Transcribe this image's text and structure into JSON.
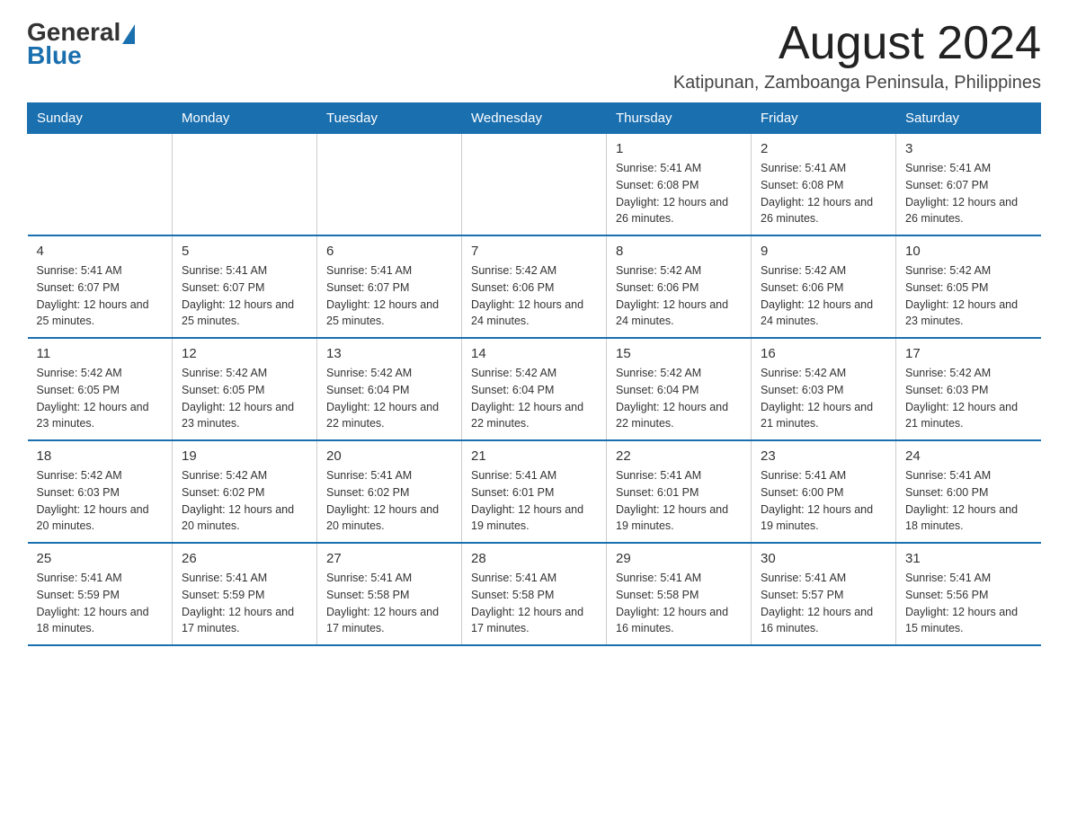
{
  "logo": {
    "text_general": "General",
    "text_blue": "Blue"
  },
  "header": {
    "month_title": "August 2024",
    "subtitle": "Katipunan, Zamboanga Peninsula, Philippines"
  },
  "weekdays": [
    "Sunday",
    "Monday",
    "Tuesday",
    "Wednesday",
    "Thursday",
    "Friday",
    "Saturday"
  ],
  "weeks": [
    [
      {
        "day": "",
        "info": ""
      },
      {
        "day": "",
        "info": ""
      },
      {
        "day": "",
        "info": ""
      },
      {
        "day": "",
        "info": ""
      },
      {
        "day": "1",
        "info": "Sunrise: 5:41 AM\nSunset: 6:08 PM\nDaylight: 12 hours and 26 minutes."
      },
      {
        "day": "2",
        "info": "Sunrise: 5:41 AM\nSunset: 6:08 PM\nDaylight: 12 hours and 26 minutes."
      },
      {
        "day": "3",
        "info": "Sunrise: 5:41 AM\nSunset: 6:07 PM\nDaylight: 12 hours and 26 minutes."
      }
    ],
    [
      {
        "day": "4",
        "info": "Sunrise: 5:41 AM\nSunset: 6:07 PM\nDaylight: 12 hours and 25 minutes."
      },
      {
        "day": "5",
        "info": "Sunrise: 5:41 AM\nSunset: 6:07 PM\nDaylight: 12 hours and 25 minutes."
      },
      {
        "day": "6",
        "info": "Sunrise: 5:41 AM\nSunset: 6:07 PM\nDaylight: 12 hours and 25 minutes."
      },
      {
        "day": "7",
        "info": "Sunrise: 5:42 AM\nSunset: 6:06 PM\nDaylight: 12 hours and 24 minutes."
      },
      {
        "day": "8",
        "info": "Sunrise: 5:42 AM\nSunset: 6:06 PM\nDaylight: 12 hours and 24 minutes."
      },
      {
        "day": "9",
        "info": "Sunrise: 5:42 AM\nSunset: 6:06 PM\nDaylight: 12 hours and 24 minutes."
      },
      {
        "day": "10",
        "info": "Sunrise: 5:42 AM\nSunset: 6:05 PM\nDaylight: 12 hours and 23 minutes."
      }
    ],
    [
      {
        "day": "11",
        "info": "Sunrise: 5:42 AM\nSunset: 6:05 PM\nDaylight: 12 hours and 23 minutes."
      },
      {
        "day": "12",
        "info": "Sunrise: 5:42 AM\nSunset: 6:05 PM\nDaylight: 12 hours and 23 minutes."
      },
      {
        "day": "13",
        "info": "Sunrise: 5:42 AM\nSunset: 6:04 PM\nDaylight: 12 hours and 22 minutes."
      },
      {
        "day": "14",
        "info": "Sunrise: 5:42 AM\nSunset: 6:04 PM\nDaylight: 12 hours and 22 minutes."
      },
      {
        "day": "15",
        "info": "Sunrise: 5:42 AM\nSunset: 6:04 PM\nDaylight: 12 hours and 22 minutes."
      },
      {
        "day": "16",
        "info": "Sunrise: 5:42 AM\nSunset: 6:03 PM\nDaylight: 12 hours and 21 minutes."
      },
      {
        "day": "17",
        "info": "Sunrise: 5:42 AM\nSunset: 6:03 PM\nDaylight: 12 hours and 21 minutes."
      }
    ],
    [
      {
        "day": "18",
        "info": "Sunrise: 5:42 AM\nSunset: 6:03 PM\nDaylight: 12 hours and 20 minutes."
      },
      {
        "day": "19",
        "info": "Sunrise: 5:42 AM\nSunset: 6:02 PM\nDaylight: 12 hours and 20 minutes."
      },
      {
        "day": "20",
        "info": "Sunrise: 5:41 AM\nSunset: 6:02 PM\nDaylight: 12 hours and 20 minutes."
      },
      {
        "day": "21",
        "info": "Sunrise: 5:41 AM\nSunset: 6:01 PM\nDaylight: 12 hours and 19 minutes."
      },
      {
        "day": "22",
        "info": "Sunrise: 5:41 AM\nSunset: 6:01 PM\nDaylight: 12 hours and 19 minutes."
      },
      {
        "day": "23",
        "info": "Sunrise: 5:41 AM\nSunset: 6:00 PM\nDaylight: 12 hours and 19 minutes."
      },
      {
        "day": "24",
        "info": "Sunrise: 5:41 AM\nSunset: 6:00 PM\nDaylight: 12 hours and 18 minutes."
      }
    ],
    [
      {
        "day": "25",
        "info": "Sunrise: 5:41 AM\nSunset: 5:59 PM\nDaylight: 12 hours and 18 minutes."
      },
      {
        "day": "26",
        "info": "Sunrise: 5:41 AM\nSunset: 5:59 PM\nDaylight: 12 hours and 17 minutes."
      },
      {
        "day": "27",
        "info": "Sunrise: 5:41 AM\nSunset: 5:58 PM\nDaylight: 12 hours and 17 minutes."
      },
      {
        "day": "28",
        "info": "Sunrise: 5:41 AM\nSunset: 5:58 PM\nDaylight: 12 hours and 17 minutes."
      },
      {
        "day": "29",
        "info": "Sunrise: 5:41 AM\nSunset: 5:58 PM\nDaylight: 12 hours and 16 minutes."
      },
      {
        "day": "30",
        "info": "Sunrise: 5:41 AM\nSunset: 5:57 PM\nDaylight: 12 hours and 16 minutes."
      },
      {
        "day": "31",
        "info": "Sunrise: 5:41 AM\nSunset: 5:56 PM\nDaylight: 12 hours and 15 minutes."
      }
    ]
  ]
}
